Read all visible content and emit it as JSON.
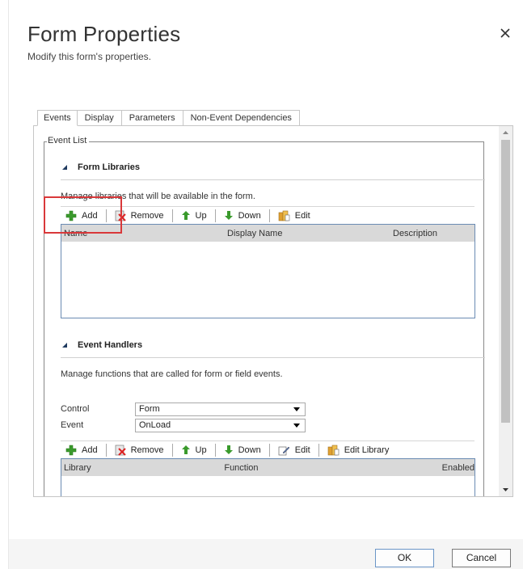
{
  "dialog": {
    "title": "Form Properties",
    "subtitle": "Modify this form's properties."
  },
  "tabs": [
    {
      "label": "Events",
      "active": true
    },
    {
      "label": "Display",
      "active": false
    },
    {
      "label": "Parameters",
      "active": false
    },
    {
      "label": "Non-Event Dependencies",
      "active": false
    }
  ],
  "event_list": {
    "legend": "Event List",
    "form_libraries": {
      "heading": "Form Libraries",
      "description": "Manage libraries that will be available in the form.",
      "toolbar": {
        "add": "Add",
        "remove": "Remove",
        "up": "Up",
        "down": "Down",
        "edit": "Edit"
      },
      "columns": [
        "Name",
        "Display Name",
        "Description"
      ]
    },
    "event_handlers": {
      "heading": "Event Handlers",
      "description": "Manage functions that are called for form or field events.",
      "control_label": "Control",
      "control_value": "Form",
      "event_label": "Event",
      "event_value": "OnLoad",
      "toolbar": {
        "add": "Add",
        "remove": "Remove",
        "up": "Up",
        "down": "Down",
        "edit": "Edit",
        "edit_library": "Edit Library"
      },
      "columns": [
        "Library",
        "Function",
        "Enabled"
      ]
    }
  },
  "footer": {
    "ok": "OK",
    "cancel": "Cancel"
  },
  "colors": {
    "highlight": "#d9383a",
    "grid_border": "#6a8bb3",
    "add_icon": "#3a9a2c"
  }
}
